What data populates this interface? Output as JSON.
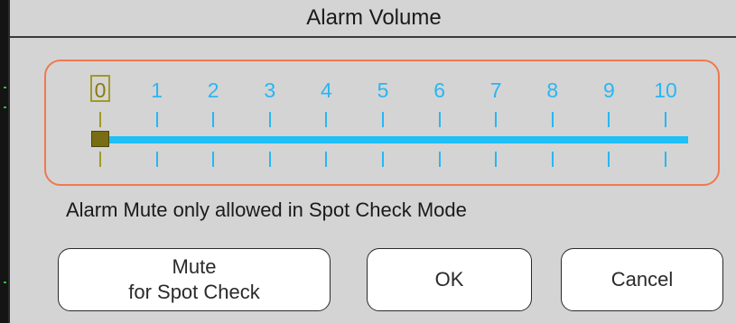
{
  "dialog": {
    "title": "Alarm Volume",
    "message": "Alarm Mute only allowed in Spot Check Mode"
  },
  "volume": {
    "value": 0,
    "min": 0,
    "max": 10,
    "labels": [
      "0",
      "1",
      "2",
      "3",
      "4",
      "5",
      "6",
      "7",
      "8",
      "9",
      "10"
    ]
  },
  "buttons": {
    "mute_line1": "Mute",
    "mute_line2": "for Spot Check",
    "ok": "OK",
    "cancel": "Cancel"
  },
  "colors": {
    "frame_border": "#f07850",
    "scale": "#29b6f2",
    "selected": "#a09a28",
    "thumb": "#786c14"
  }
}
